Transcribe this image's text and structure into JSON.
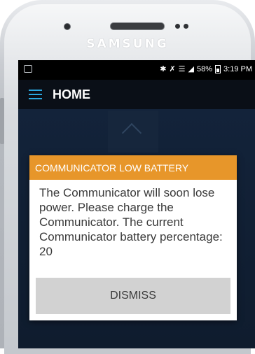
{
  "device": {
    "brand": "SAMSUNG"
  },
  "status_bar": {
    "battery_percent": "58%",
    "time": "3:19 PM",
    "icons": [
      "notification-icon",
      "bluetooth-icon",
      "mute-icon",
      "wifi-icon",
      "signal-icon",
      "battery-icon"
    ]
  },
  "app_bar": {
    "title": "HOME",
    "menu_icon": "hamburger-menu-icon",
    "accent_color": "#2aa7df"
  },
  "dialog": {
    "title": "COMMUNICATOR LOW BATTERY",
    "message": "The Communicator will soon lose power. Please charge the Communicator. The current Communicator battery percentage: 20",
    "dismiss_label": "DISMISS",
    "header_color": "#e7962a"
  }
}
